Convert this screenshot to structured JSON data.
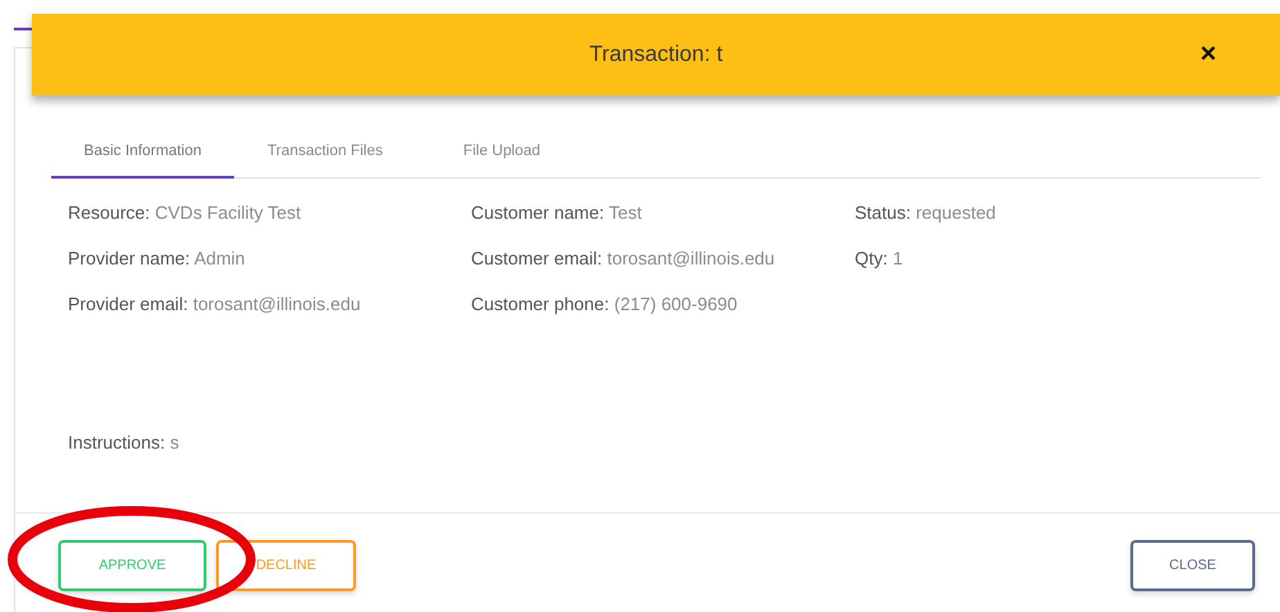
{
  "header": {
    "title": "Transaction: t",
    "close": "×"
  },
  "tabs": [
    {
      "label": "Basic Information",
      "selected": true
    },
    {
      "label": "Transaction Files",
      "selected": false
    },
    {
      "label": "File Upload",
      "selected": false
    }
  ],
  "columns": [
    [
      {
        "label": "Resource:",
        "value": "CVDs Facility Test"
      },
      {
        "label": "Provider name:",
        "value": "Admin"
      },
      {
        "label": "Provider email:",
        "value": "torosant@illinois.edu"
      }
    ],
    [
      {
        "label": "Customer name:",
        "value": "Test"
      },
      {
        "label": "Customer email:",
        "value": "torosant@illinois.edu"
      },
      {
        "label": "Customer phone:",
        "value": "(217) 600-9690"
      }
    ],
    [
      {
        "label": "Status:",
        "value": "requested"
      },
      {
        "label": "Qty:",
        "value": "1"
      }
    ]
  ],
  "instructions": {
    "label": "Instructions:",
    "value": "s"
  },
  "actions": [
    {
      "label": "APPROVE",
      "kind": "approve"
    },
    {
      "label": "DECLINE",
      "kind": "decline"
    },
    {
      "label": "CLOSE",
      "kind": "close"
    }
  ]
}
